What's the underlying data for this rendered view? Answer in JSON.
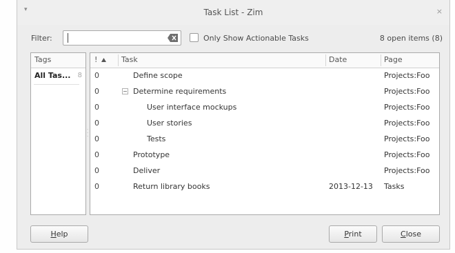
{
  "window": {
    "title": "Task List - Zim",
    "menu_glyph": "▾",
    "close_glyph": "×"
  },
  "filter": {
    "label": "Filter:",
    "value": "",
    "actionable_label": "Only Show Actionable Tasks",
    "actionable_checked": false,
    "open_count": "8 open items (8)"
  },
  "tags": {
    "header": "Tags",
    "items": [
      {
        "name": "All Tas...",
        "count": "8"
      }
    ]
  },
  "tasks": {
    "columns": {
      "priority": "!",
      "task": "Task",
      "date": "Date",
      "page": "Page"
    },
    "rows": [
      {
        "priority": "0",
        "task": "Define scope",
        "date": "",
        "page": "Projects:Foo",
        "indent": 0,
        "expander": false
      },
      {
        "priority": "0",
        "task": "Determine requirements",
        "date": "",
        "page": "Projects:Foo",
        "indent": 0,
        "expander": true
      },
      {
        "priority": "0",
        "task": "User interface mockups",
        "date": "",
        "page": "Projects:Foo",
        "indent": 1,
        "expander": false
      },
      {
        "priority": "0",
        "task": "User stories",
        "date": "",
        "page": "Projects:Foo",
        "indent": 1,
        "expander": false
      },
      {
        "priority": "0",
        "task": "Tests",
        "date": "",
        "page": "Projects:Foo",
        "indent": 1,
        "expander": false
      },
      {
        "priority": "0",
        "task": "Prototype",
        "date": "",
        "page": "Projects:Foo",
        "indent": 0,
        "expander": false
      },
      {
        "priority": "0",
        "task": "Deliver",
        "date": "",
        "page": "Projects:Foo",
        "indent": 0,
        "expander": false
      },
      {
        "priority": "0",
        "task": "Return library books",
        "date": "2013-12-13",
        "page": "Tasks",
        "indent": 0,
        "expander": false
      }
    ]
  },
  "buttons": {
    "help": {
      "mnemonic": "H",
      "rest": "elp"
    },
    "print": {
      "mnemonic": "P",
      "rest": "rint"
    },
    "close": {
      "mnemonic": "C",
      "rest": "lose"
    }
  }
}
